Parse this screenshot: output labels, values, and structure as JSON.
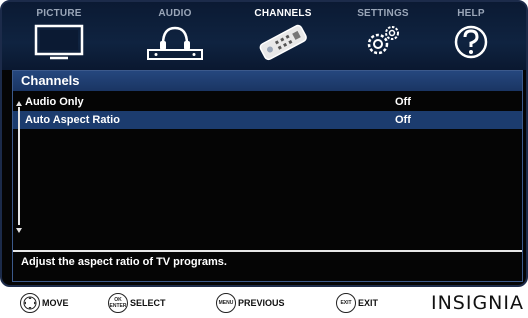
{
  "tabs": [
    {
      "label": "PICTURE",
      "icon": "tv-icon",
      "active": false
    },
    {
      "label": "AUDIO",
      "icon": "headphones-icon",
      "active": false
    },
    {
      "label": "CHANNELS",
      "icon": "remote-icon",
      "active": true
    },
    {
      "label": "SETTINGS",
      "icon": "gears-icon",
      "active": false
    },
    {
      "label": "HELP",
      "icon": "help-icon",
      "active": false
    }
  ],
  "panel": {
    "title": "Channels",
    "rows": [
      {
        "label": "Audio Only",
        "value": "Off",
        "selected": false
      },
      {
        "label": "Auto Aspect Ratio",
        "value": "Off",
        "selected": true
      }
    ],
    "help_text": "Adjust the aspect ratio of TV programs."
  },
  "footer": {
    "hints": [
      {
        "button": "",
        "label": "MOVE"
      },
      {
        "button": "OK ENTER",
        "label": "SELECT"
      },
      {
        "button": "MENU",
        "label": "PREVIOUS"
      },
      {
        "button": "EXIT",
        "label": "EXIT"
      }
    ],
    "brand": "INSIGNIA"
  },
  "colors": {
    "highlight": "#1c3c6e",
    "title_bar": "#25477e",
    "top_bar": "#0f2340"
  }
}
